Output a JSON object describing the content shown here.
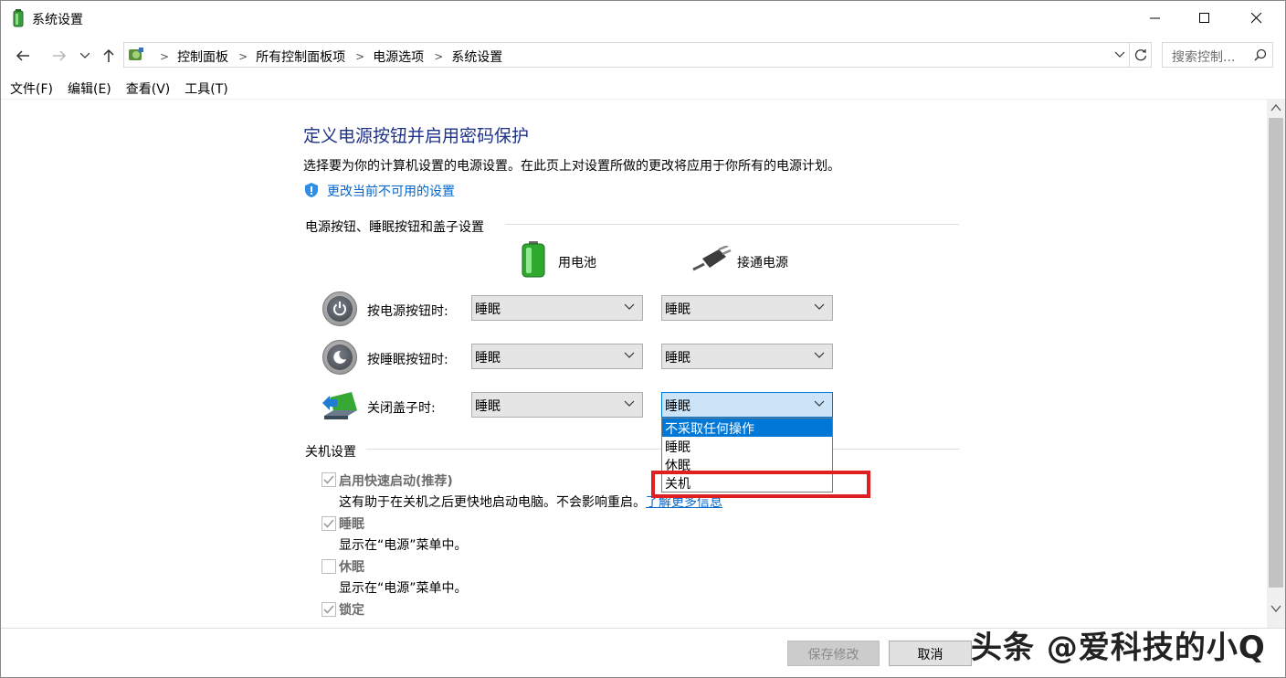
{
  "window": {
    "title": "系统设置",
    "controls": {
      "minimize_icon": "minimize-icon",
      "maximize_icon": "maximize-icon",
      "close_icon": "close-icon"
    }
  },
  "navigation": {
    "breadcrumbs": [
      "控制面板",
      "所有控制面板项",
      "电源选项",
      "系统设置"
    ],
    "search_placeholder": "搜索控制..."
  },
  "menu": [
    "文件(F)",
    "编辑(E)",
    "查看(V)",
    "工具(T)"
  ],
  "main": {
    "heading": "定义电源按钮并启用密码保护",
    "description": "选择要为你的计算机设置的电源设置。在此页上对设置所做的更改将应用于你所有的电源计划。",
    "change_link": "更改当前不可用的设置",
    "section_buttons": {
      "title": "电源按钮、睡眠按钮和盖子设置",
      "columns": {
        "battery": "用电池",
        "plugged": "接通电源"
      },
      "rows": [
        {
          "label": "按电源按钮时:",
          "battery": "睡眠",
          "plugged": "睡眠"
        },
        {
          "label": "按睡眠按钮时:",
          "battery": "睡眠",
          "plugged": "睡眠"
        },
        {
          "label": "关闭盖子时:",
          "battery": "睡眠",
          "plugged": "睡眠"
        }
      ],
      "open_dropdown": {
        "options": [
          "不采取任何操作",
          "睡眠",
          "休眠",
          "关机"
        ],
        "highlighted": "不采取任何操作",
        "annotated_option": "关机",
        "annotation_color": "#e02020"
      }
    },
    "section_shutdown": {
      "title": "关机设置",
      "items": [
        {
          "label": "启用快速启动(推荐)",
          "checked": true,
          "desc": "这有助于在关机之后更快地启动电脑。不会影响重启。",
          "link": "了解更多信息"
        },
        {
          "label": "睡眠",
          "checked": true,
          "desc": "显示在“电源”菜单中。"
        },
        {
          "label": "休眠",
          "checked": false,
          "desc": "显示在“电源”菜单中。"
        },
        {
          "label": "锁定",
          "checked": true
        }
      ]
    }
  },
  "footer": {
    "save_label": "保存修改",
    "cancel_label": "取消"
  },
  "watermark": "头条 @爱科技的小Q",
  "colors": {
    "heading": "#1e3287",
    "link": "#0066cc",
    "selection": "#0078d7"
  }
}
